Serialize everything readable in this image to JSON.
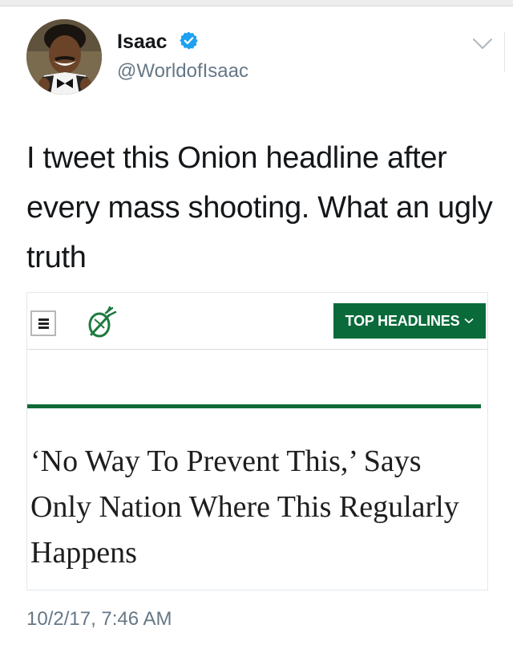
{
  "tweet": {
    "display_name": "Isaac",
    "handle": "@WorldofIsaac",
    "text": "I tweet this Onion headline after every mass shooting. What an ugly truth",
    "timestamp": "10/2/17, 7:46 AM"
  },
  "card": {
    "nav_button_label": "TOP HEADLINES",
    "headline": "‘No Way To Prevent This,’ Says Only Nation Where This Regularly Happens"
  },
  "colors": {
    "verified_badge": "#1da1f2",
    "onion_green": "#0a6a3a",
    "handle_gray": "#657786"
  },
  "icons": {
    "verified": "verified-badge-icon",
    "caret": "chevron-down-icon",
    "menu": "hamburger-menu-icon",
    "logo": "onion-logo-icon"
  }
}
